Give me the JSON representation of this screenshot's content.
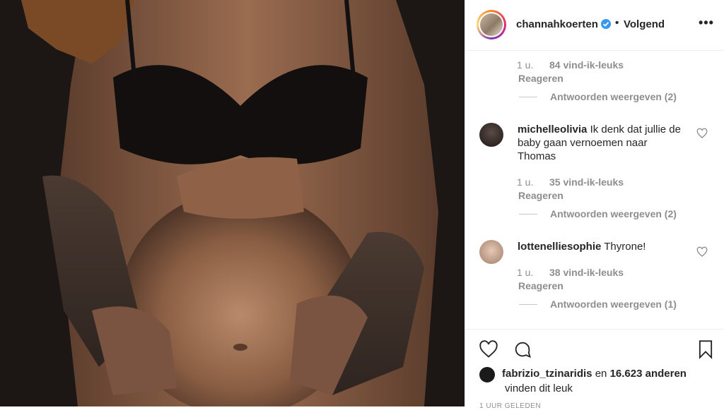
{
  "post": {
    "username": "channahkoerten",
    "follow_status": "Volgend",
    "separator": "•"
  },
  "comments": [
    {
      "time": "1 u.",
      "likes": "84 vind-ik-leuks",
      "reply": "Reageren",
      "view_replies": "Antwoorden weergeven (2)"
    },
    {
      "user": "michelleolivia",
      "text": "Ik denk dat jullie de baby gaan vernoemen naar Thomas",
      "time": "1 u.",
      "likes": "35 vind-ik-leuks",
      "reply": "Reageren",
      "view_replies": "Antwoorden weergeven (2)"
    },
    {
      "user": "lottenelliesophie",
      "text": "Thyrone!",
      "time": "1 u.",
      "likes": "38 vind-ik-leuks",
      "reply": "Reageren",
      "view_replies": "Antwoorden weergeven (1)"
    }
  ],
  "likes_summary": {
    "user": "fabrizio_tzinaridis",
    "connector": "en",
    "count": "16.623 anderen",
    "suffix": "vinden dit leuk"
  },
  "time_ago": "1 UUR GELEDEN",
  "icons": {
    "verified": "verified-badge-icon",
    "more": "more-options-icon",
    "like": "heart-icon",
    "comment": "comment-icon",
    "save": "bookmark-icon"
  },
  "colors": {
    "verified": "#3897f0",
    "muted_text": "#8e8e8e",
    "primary_text": "#262626"
  }
}
